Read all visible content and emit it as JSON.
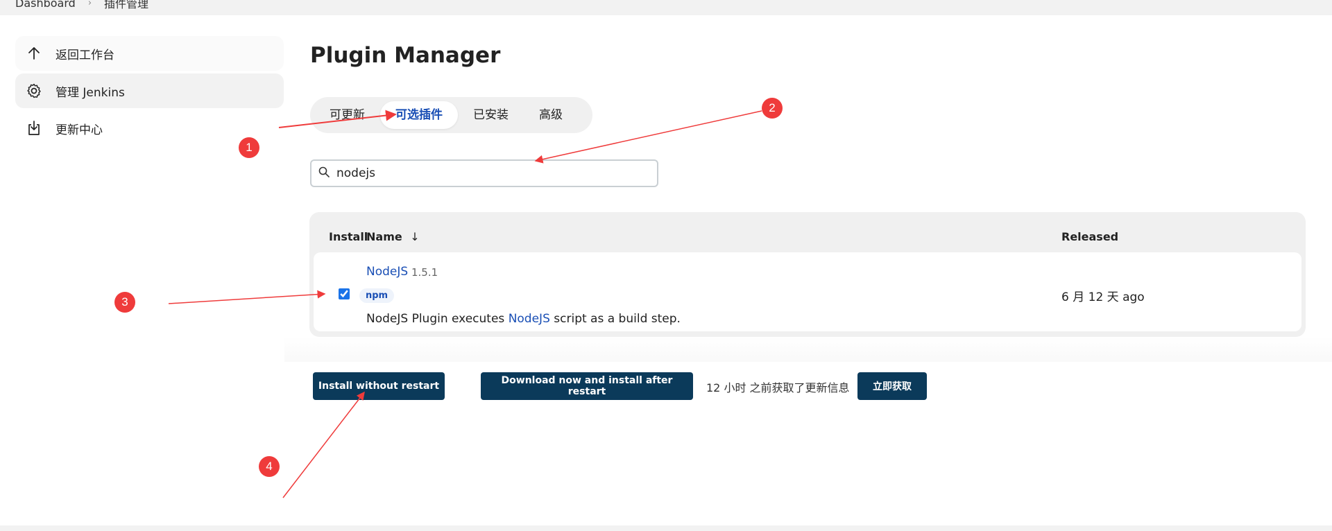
{
  "breadcrumb": {
    "home": "Dashboard",
    "current": "插件管理"
  },
  "sidebar": {
    "items": [
      {
        "label": "返回工作台",
        "icon": "arrow-up-icon"
      },
      {
        "label": "管理 Jenkins",
        "icon": "gear-icon"
      },
      {
        "label": "更新中心",
        "icon": "download-icon"
      }
    ]
  },
  "page": {
    "title": "Plugin Manager"
  },
  "tabs": [
    {
      "label": "可更新"
    },
    {
      "label": "可选插件"
    },
    {
      "label": "已安装"
    },
    {
      "label": "高级"
    }
  ],
  "search": {
    "value": "nodejs",
    "icon": "search-icon"
  },
  "table": {
    "headers": {
      "install": "Install",
      "name": "Name",
      "sort_arrow": "↓",
      "released": "Released"
    },
    "rows": [
      {
        "checked": true,
        "name": "NodeJS",
        "version": "1.5.1",
        "tag": "npm",
        "desc_prefix": "NodeJS Plugin executes ",
        "desc_link": "NodeJS",
        "desc_suffix": " script as a build step.",
        "released": "6 月 12 天 ago"
      }
    ]
  },
  "actions": {
    "install_without_restart": "Install without restart",
    "download_install_after_restart": "Download now and install after restart",
    "update_info": "12 小时 之前获取了更新信息",
    "fetch_now": "立即获取"
  },
  "annotations": {
    "markers": [
      "1",
      "2",
      "3",
      "4"
    ],
    "color": "#ef3b3b"
  }
}
